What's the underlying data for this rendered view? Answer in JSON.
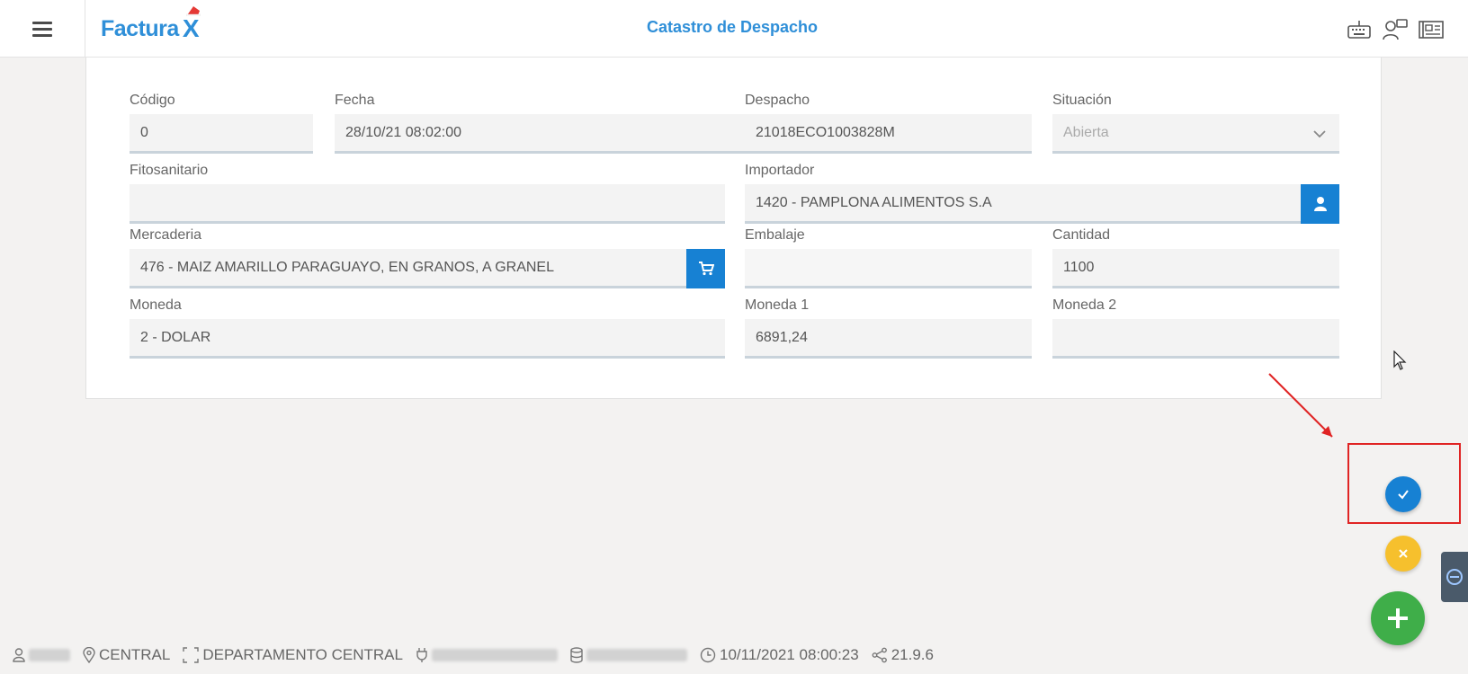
{
  "header": {
    "logo_text": "Factura",
    "logo_x": "X",
    "title": "Catastro de Despacho",
    "icons": [
      "keyboard-icon",
      "users-chat-icon",
      "newspaper-icon"
    ]
  },
  "form": {
    "codigo": {
      "label": "Código",
      "value": "0"
    },
    "fecha": {
      "label": "Fecha",
      "value": "28/10/21 08:02:00"
    },
    "despacho": {
      "label": "Despacho",
      "value": "21018ECO1003828M"
    },
    "situacion": {
      "label": "Situación",
      "value": "Abierta"
    },
    "fitosanitario": {
      "label": "Fitosanitario",
      "value": ""
    },
    "importador": {
      "label": "Importador",
      "value": "1420 - PAMPLONA ALIMENTOS S.A"
    },
    "mercaderia": {
      "label": "Mercaderia",
      "value": "476 - MAIZ AMARILLO PARAGUAYO, EN GRANOS, A GRANEL"
    },
    "embalaje": {
      "label": "Embalaje",
      "value": ""
    },
    "cantidad": {
      "label": "Cantidad",
      "value": "1100"
    },
    "moneda": {
      "label": "Moneda",
      "value": "2 - DOLAR"
    },
    "moneda1": {
      "label": "Moneda 1",
      "value": "6891,24"
    },
    "moneda2": {
      "label": "Moneda 2",
      "value": ""
    }
  },
  "status_bar": {
    "branch": "CENTRAL",
    "department": "DEPARTAMENTO CENTRAL",
    "datetime": "10/11/2021 08:00:23",
    "version": "21.9.6"
  },
  "colors": {
    "accent": "#1781d3",
    "confirm": "#1781d3",
    "cancel": "#f6c02d",
    "add": "#3fae49",
    "highlight": "#e02424"
  }
}
